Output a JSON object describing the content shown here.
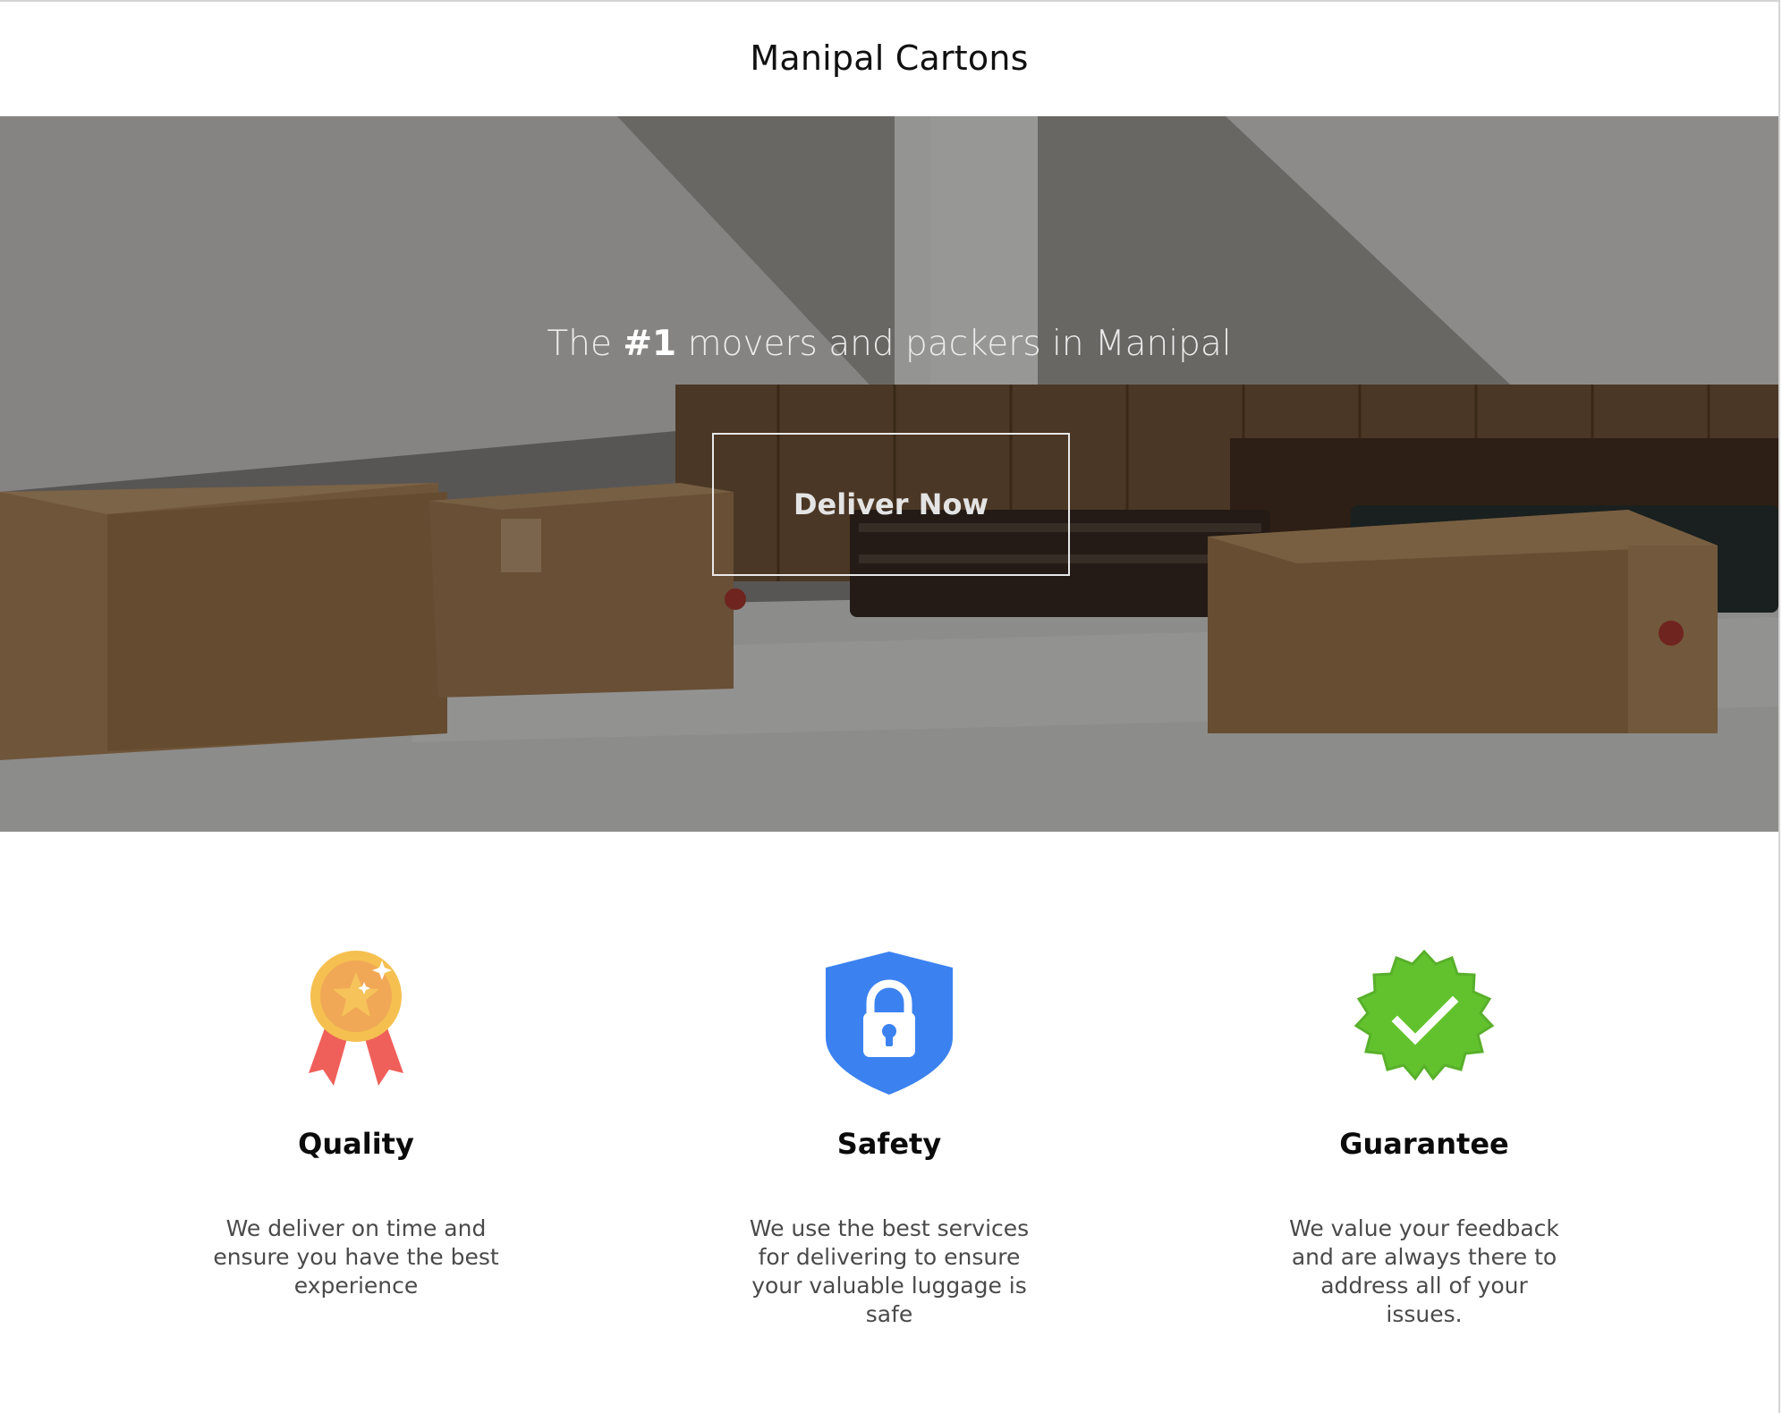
{
  "header": {
    "brand": "Manipal Cartons"
  },
  "hero": {
    "heading_prefix": "The ",
    "heading_bold": "#1",
    "heading_suffix": " movers and packers in Manipal",
    "cta_label": "Deliver Now"
  },
  "features": [
    {
      "icon": "medal-icon",
      "title": "Quality",
      "text": "We deliver on time and ensure you have the best experience"
    },
    {
      "icon": "shield-lock-icon",
      "title": "Safety",
      "text": "We use the best services for delivering to ensure your valuable luggage is safe"
    },
    {
      "icon": "verified-badge-icon",
      "title": "Guarantee",
      "text": "We value your feedback and are always there to address all of your issues."
    }
  ],
  "colors": {
    "shield_blue": "#3b82f0",
    "badge_green": "#62c22e",
    "medal_gold": "#f5c050",
    "ribbon_red": "#f0605a"
  }
}
